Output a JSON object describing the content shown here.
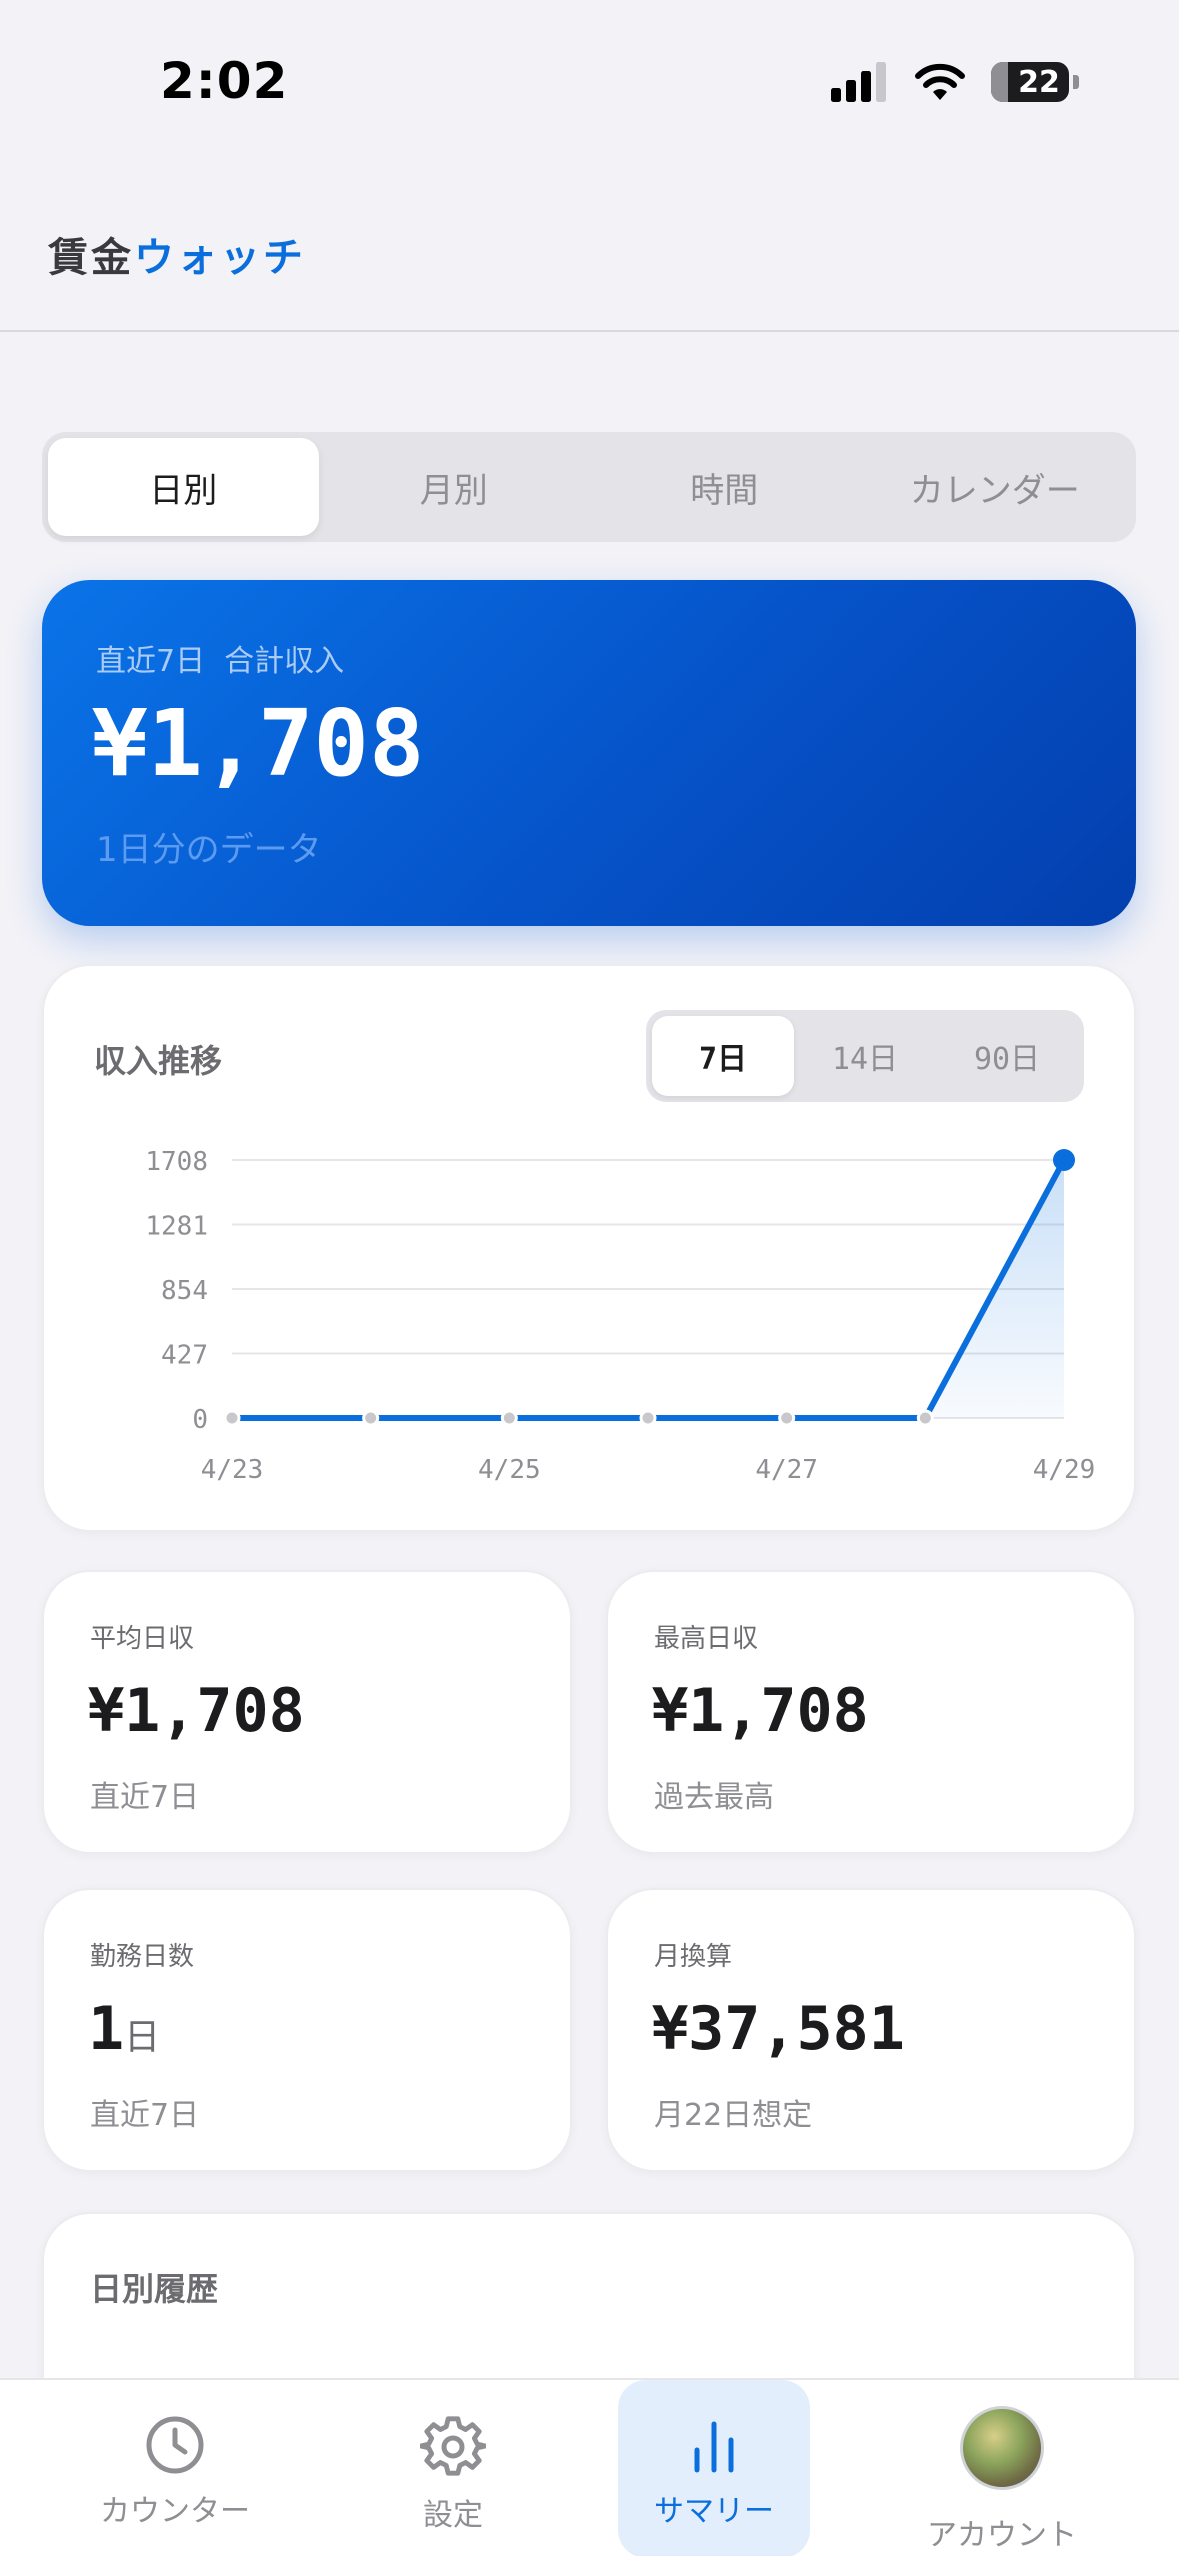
{
  "status": {
    "time": "2:02",
    "battery": "22",
    "battery_level": 0.22
  },
  "header": {
    "title_part1": "賃金",
    "title_part2": "ウォッチ"
  },
  "tabs": [
    {
      "label": "日別",
      "active": true
    },
    {
      "label": "月別",
      "active": false
    },
    {
      "label": "時間",
      "active": false
    },
    {
      "label": "カレンダー",
      "active": false
    }
  ],
  "hero": {
    "label": "直近7日  合計収入",
    "value": "¥1,708",
    "sub": "1日分のデータ"
  },
  "trend": {
    "title": "収入推移",
    "ranges": [
      {
        "label": "7日",
        "active": true
      },
      {
        "label": "14日",
        "active": false
      },
      {
        "label": "90日",
        "active": false
      }
    ]
  },
  "chart_data": {
    "type": "line",
    "title": "収入推移",
    "x": [
      "4/23",
      "4/24",
      "4/25",
      "4/26",
      "4/27",
      "4/28",
      "4/29"
    ],
    "x_tick_labels": [
      "4/23",
      "4/25",
      "4/27",
      "4/29"
    ],
    "series": [
      {
        "values": [
          0,
          0,
          0,
          0,
          0,
          0,
          1708
        ]
      }
    ],
    "y_ticks": [
      0,
      427,
      854,
      1281,
      1708
    ],
    "ylim": [
      0,
      1708
    ],
    "grid": true,
    "color": "#0a6fdc"
  },
  "stats": {
    "avg": {
      "label": "平均日収",
      "value": "¥1,708",
      "sub": "直近7日"
    },
    "max": {
      "label": "最高日収",
      "value": "¥1,708",
      "sub": "過去最高"
    },
    "days": {
      "label": "勤務日数",
      "value": "1",
      "unit": "日",
      "sub": "直近7日"
    },
    "monthly": {
      "label": "月換算",
      "value": "¥37,581",
      "sub": "月22日想定"
    }
  },
  "history": {
    "title": "日別履歴"
  },
  "tabbar": [
    {
      "label": "カウンター",
      "icon": "clock-icon"
    },
    {
      "label": "設定",
      "icon": "gear-icon"
    },
    {
      "label": "サマリー",
      "icon": "bar-chart-icon",
      "active": true
    },
    {
      "label": "アカウント",
      "icon": "avatar"
    }
  ],
  "colors": {
    "accent": "#0a6fdc",
    "hero_start": "#0a74e8",
    "hero_end": "#033fae"
  }
}
